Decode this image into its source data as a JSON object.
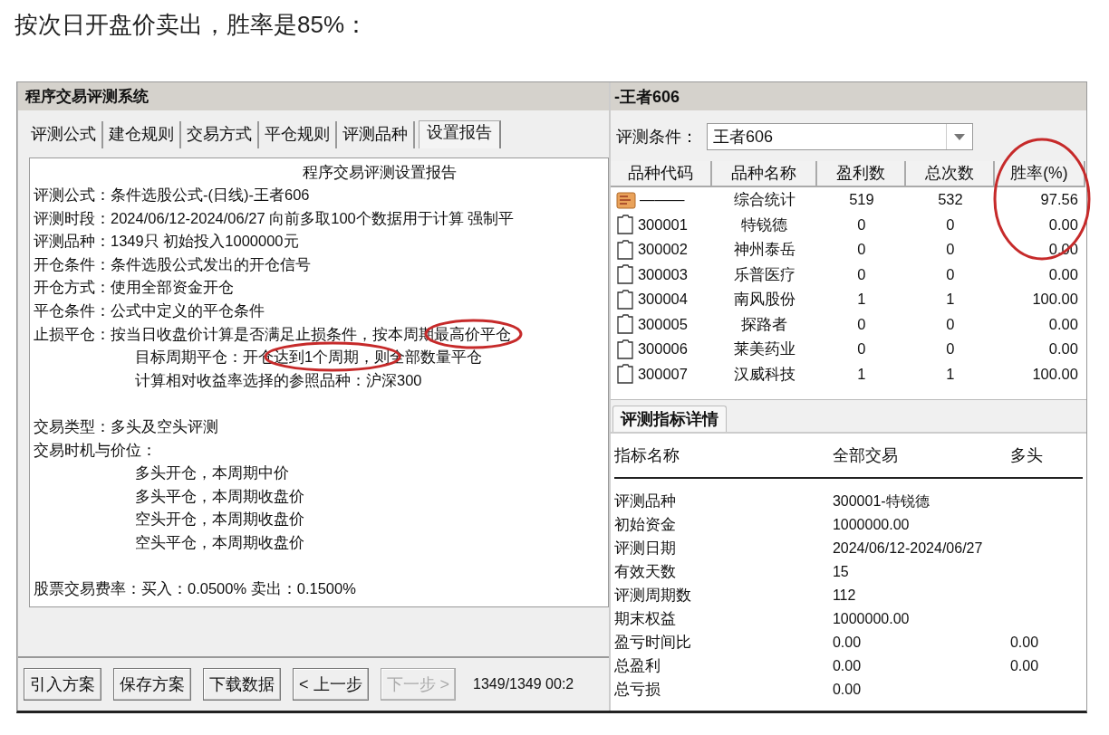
{
  "heading": "按次日开盘价卖出，胜率是85%：",
  "left": {
    "title": "程序交易评测系统",
    "tabs": [
      {
        "label": "评测公式",
        "selected": false
      },
      {
        "label": "建仓规则",
        "selected": false
      },
      {
        "label": "交易方式",
        "selected": false
      },
      {
        "label": "平仓规则",
        "selected": false
      },
      {
        "label": "评测品种",
        "selected": false
      },
      {
        "label": "设置报告",
        "selected": true
      }
    ],
    "report": {
      "title": "程序交易评测设置报告",
      "lines": [
        {
          "kind": "line",
          "indent": false,
          "parts": [
            {
              "text": "评测公式：条件选股公式-(日线)-王者606",
              "circled": false
            }
          ]
        },
        {
          "kind": "line",
          "indent": false,
          "parts": [
            {
              "text": "评测时段：2024/06/12-2024/06/27 向前多取100个数据用于计算 强制平",
              "circled": false
            }
          ]
        },
        {
          "kind": "line",
          "indent": false,
          "parts": [
            {
              "text": "评测品种：1349只 初始投入1000000元",
              "circled": false
            }
          ]
        },
        {
          "kind": "line",
          "indent": false,
          "parts": [
            {
              "text": "开仓条件：条件选股公式发出的开仓信号",
              "circled": false
            }
          ]
        },
        {
          "kind": "line",
          "indent": false,
          "parts": [
            {
              "text": "开仓方式：使用全部资金开仓",
              "circled": false
            }
          ]
        },
        {
          "kind": "line",
          "indent": false,
          "parts": [
            {
              "text": "平仓条件：公式中定义的平仓条件",
              "circled": false
            }
          ]
        },
        {
          "kind": "line",
          "indent": false,
          "parts": [
            {
              "text": "止损平仓：按当日收盘价计算是否满足止损条件，按本周期",
              "circled": false
            },
            {
              "text": "最高价平仓",
              "circled": true
            }
          ]
        },
        {
          "kind": "line",
          "indent": true,
          "parts": [
            {
              "text": "目标周期平仓：开仓",
              "circled": false
            },
            {
              "text": "达到1个周期，则",
              "circled": true
            },
            {
              "text": "全部数量平仓",
              "circled": false
            }
          ]
        },
        {
          "kind": "line",
          "indent": true,
          "parts": [
            {
              "text": "计算相对收益率选择的参照品种：沪深300",
              "circled": false
            }
          ]
        },
        {
          "kind": "gap"
        },
        {
          "kind": "line",
          "indent": false,
          "parts": [
            {
              "text": "交易类型：多头及空头评测",
              "circled": false
            }
          ]
        },
        {
          "kind": "line",
          "indent": false,
          "parts": [
            {
              "text": "交易时机与价位：",
              "circled": false
            }
          ]
        },
        {
          "kind": "line",
          "indent": true,
          "parts": [
            {
              "text": "多头开仓，本周期中价",
              "circled": false
            }
          ]
        },
        {
          "kind": "line",
          "indent": true,
          "parts": [
            {
              "text": "多头平仓，本周期收盘价",
              "circled": false
            }
          ]
        },
        {
          "kind": "line",
          "indent": true,
          "parts": [
            {
              "text": "空头开仓，本周期收盘价",
              "circled": false
            }
          ]
        },
        {
          "kind": "line",
          "indent": true,
          "parts": [
            {
              "text": "空头平仓，本周期收盘价",
              "circled": false
            }
          ]
        },
        {
          "kind": "gap"
        },
        {
          "kind": "line",
          "indent": false,
          "parts": [
            {
              "text": "股票交易费率：买入：0.0500%  卖出：0.1500%",
              "circled": false
            }
          ]
        }
      ]
    },
    "buttons": [
      {
        "label": "引入方案",
        "disabled": false
      },
      {
        "label": "保存方案",
        "disabled": false
      },
      {
        "label": "下载数据",
        "disabled": false
      },
      {
        "label": "< 上一步",
        "disabled": false
      },
      {
        "label": "下一步 >",
        "disabled": true
      }
    ],
    "status": "1349/1349 00:2"
  },
  "right": {
    "title": "-王者606",
    "condition": {
      "label": "评测条件：",
      "value": "王者606"
    },
    "table": {
      "columns": [
        {
          "label": "品种代码",
          "circled": false
        },
        {
          "label": "品种名称",
          "circled": false
        },
        {
          "label": "盈利数",
          "circled": false
        },
        {
          "label": "总次数",
          "circled": false
        },
        {
          "label": "胜率(%)",
          "circled": true
        }
      ],
      "rows": [
        {
          "kind": "summary",
          "cells": [
            "———",
            "综合统计",
            "519",
            "532",
            "97.56"
          ]
        },
        {
          "kind": "stock",
          "cells": [
            "300001",
            "特锐德",
            "0",
            "0",
            "0.00"
          ]
        },
        {
          "kind": "stock",
          "cells": [
            "300002",
            "神州泰岳",
            "0",
            "0",
            "0.00"
          ]
        },
        {
          "kind": "stock",
          "cells": [
            "300003",
            "乐普医疗",
            "0",
            "0",
            "0.00"
          ]
        },
        {
          "kind": "stock",
          "cells": [
            "300004",
            "南风股份",
            "1",
            "1",
            "100.00"
          ]
        },
        {
          "kind": "stock",
          "cells": [
            "300005",
            "探路者",
            "0",
            "0",
            "0.00"
          ]
        },
        {
          "kind": "stock",
          "cells": [
            "300006",
            "莱美药业",
            "0",
            "0",
            "0.00"
          ]
        },
        {
          "kind": "stock",
          "cells": [
            "300007",
            "汉威科技",
            "1",
            "1",
            "100.00"
          ]
        }
      ]
    },
    "detail_tab": {
      "label": "评测指标详情",
      "selected": true
    },
    "details": {
      "columns": [
        "指标名称",
        "全部交易",
        "多头"
      ],
      "rows": [
        {
          "name": "评测品种",
          "all": "300001-特锐德"
        },
        {
          "name": "初始资金",
          "all": "1000000.00"
        },
        {
          "name": "评测日期",
          "all": "2024/06/12-2024/06/27"
        },
        {
          "name": "有效天数",
          "all": "15"
        },
        {
          "name": "评测周期数",
          "all": "112"
        },
        {
          "name": "期末权益",
          "all": "1000000.00"
        },
        {
          "name": "盈亏时间比",
          "all": "0.00",
          "long": "0.00"
        },
        {
          "name": "总盈利",
          "all": "0.00",
          "long": "0.00"
        },
        {
          "name": "总亏损",
          "all": "0.00"
        }
      ]
    }
  }
}
